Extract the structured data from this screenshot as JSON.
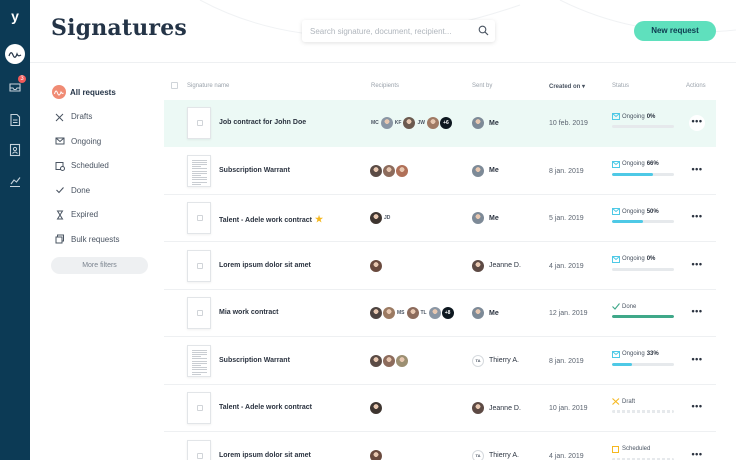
{
  "app": {
    "logo_glyph": "y",
    "nav_badge": "3"
  },
  "header": {
    "title": "Signatures",
    "search_placeholder": "Search signature, document, recipient...",
    "new_request_label": "New request"
  },
  "filters": [
    {
      "label": "All requests",
      "icon": "signature-icon",
      "active": true
    },
    {
      "label": "Drafts",
      "icon": "pen-cross-icon"
    },
    {
      "label": "Ongoing",
      "icon": "envelope-icon"
    },
    {
      "label": "Scheduled",
      "icon": "calendar-clock-icon"
    },
    {
      "label": "Done",
      "icon": "check-icon"
    },
    {
      "label": "Expired",
      "icon": "hourglass-icon"
    },
    {
      "label": "Bulk requests",
      "icon": "stack-icon"
    }
  ],
  "more_filters_label": "More filters",
  "columns": {
    "name": "Signature name",
    "recipients": "Recipients",
    "sent_by": "Sent by",
    "created_on": "Created on",
    "status": "Status",
    "actions": "Actions"
  },
  "rows": [
    {
      "name": "Job contract for John Doe",
      "recipients": [
        {
          "type": "init",
          "text": "MC"
        },
        {
          "type": "photo",
          "color": "#8a96a4"
        },
        {
          "type": "init",
          "text": "KF"
        },
        {
          "type": "photo",
          "color": "#6b5a4f"
        },
        {
          "type": "init",
          "text": "JW"
        },
        {
          "type": "photo",
          "color": "#a07a64"
        },
        {
          "type": "plus",
          "text": "+6"
        }
      ],
      "sent_by": "Me",
      "sent_photo": "#7d8a97",
      "created": "10 feb. 2019",
      "status": "Ongoing",
      "percent": "0%",
      "progress": 0,
      "status_color": "#4ec9e6",
      "highlight": true
    },
    {
      "name": "Subscription Warrant",
      "recipients": [
        {
          "type": "photo",
          "color": "#5a4b45"
        },
        {
          "type": "photo",
          "color": "#8c6b5c"
        },
        {
          "type": "photo",
          "color": "#b07058"
        }
      ],
      "sent_by": "Me",
      "sent_photo": "#7d8a97",
      "created": "8 jan. 2019",
      "status": "Ongoing",
      "percent": "66%",
      "progress": 0.66,
      "status_color": "#4ec9e6",
      "dense_doc": true
    },
    {
      "name": "Talent - Adele work contract",
      "starred": true,
      "recipients": [
        {
          "type": "photo",
          "color": "#3e3530"
        },
        {
          "type": "init",
          "text": "JD"
        }
      ],
      "sent_by": "Me",
      "sent_photo": "#7d8a97",
      "created": "5 jan. 2019",
      "status": "Ongoing",
      "percent": "50%",
      "progress": 0.5,
      "status_color": "#4ec9e6"
    },
    {
      "name": "Lorem ipsum dolor sit amet",
      "recipients": [
        {
          "type": "photo",
          "color": "#6a4a3e"
        }
      ],
      "sent_by": "Jeanne D.",
      "sent_photo": "#5d4a44",
      "created": "4 jan. 2019",
      "status": "Ongoing",
      "percent": "0%",
      "progress": 0,
      "status_color": "#4ec9e6"
    },
    {
      "name": "Mia work contract",
      "recipients": [
        {
          "type": "photo",
          "color": "#4d4340"
        },
        {
          "type": "photo",
          "color": "#9b7a62"
        },
        {
          "type": "init",
          "text": "MS"
        },
        {
          "type": "photo",
          "color": "#8c6b5c"
        },
        {
          "type": "init",
          "text": "TL"
        },
        {
          "type": "photo",
          "color": "#8a96a4"
        },
        {
          "type": "plus",
          "text": "+8"
        }
      ],
      "sent_by": "Me",
      "sent_photo": "#7d8a97",
      "created": "12 jan. 2019",
      "status": "Done",
      "percent": "",
      "progress": 1,
      "status_color": "#3fa889"
    },
    {
      "name": "Subscription Warrant",
      "recipients": [
        {
          "type": "photo",
          "color": "#5a4b45"
        },
        {
          "type": "photo",
          "color": "#8c6b5c"
        },
        {
          "type": "photo",
          "color": "#9c8f72"
        }
      ],
      "sent_by": "Thierry A.",
      "sent_init": "TA",
      "created": "8 jan. 2019",
      "status": "Ongoing",
      "percent": "33%",
      "progress": 0.33,
      "status_color": "#4ec9e6",
      "dense_doc": true
    },
    {
      "name": "Talent - Adele work contract",
      "recipients": [
        {
          "type": "photo",
          "color": "#3e3530"
        }
      ],
      "sent_by": "Jeanne D.",
      "sent_photo": "#5d4a44",
      "created": "10 jan. 2019",
      "status": "Draft",
      "percent": "",
      "progress": 0,
      "status_color": "#f5b820",
      "dashed": true
    },
    {
      "name": "Lorem ipsum dolor sit amet",
      "recipients": [
        {
          "type": "photo",
          "color": "#6a4a3e"
        }
      ],
      "sent_by": "Thierry A.",
      "sent_init": "TA",
      "created": "4 jan. 2019",
      "status": "Scheduled",
      "percent": "",
      "progress": 0,
      "status_color": "#c9ced3",
      "dashed": true
    }
  ],
  "actions_glyph": "•••"
}
